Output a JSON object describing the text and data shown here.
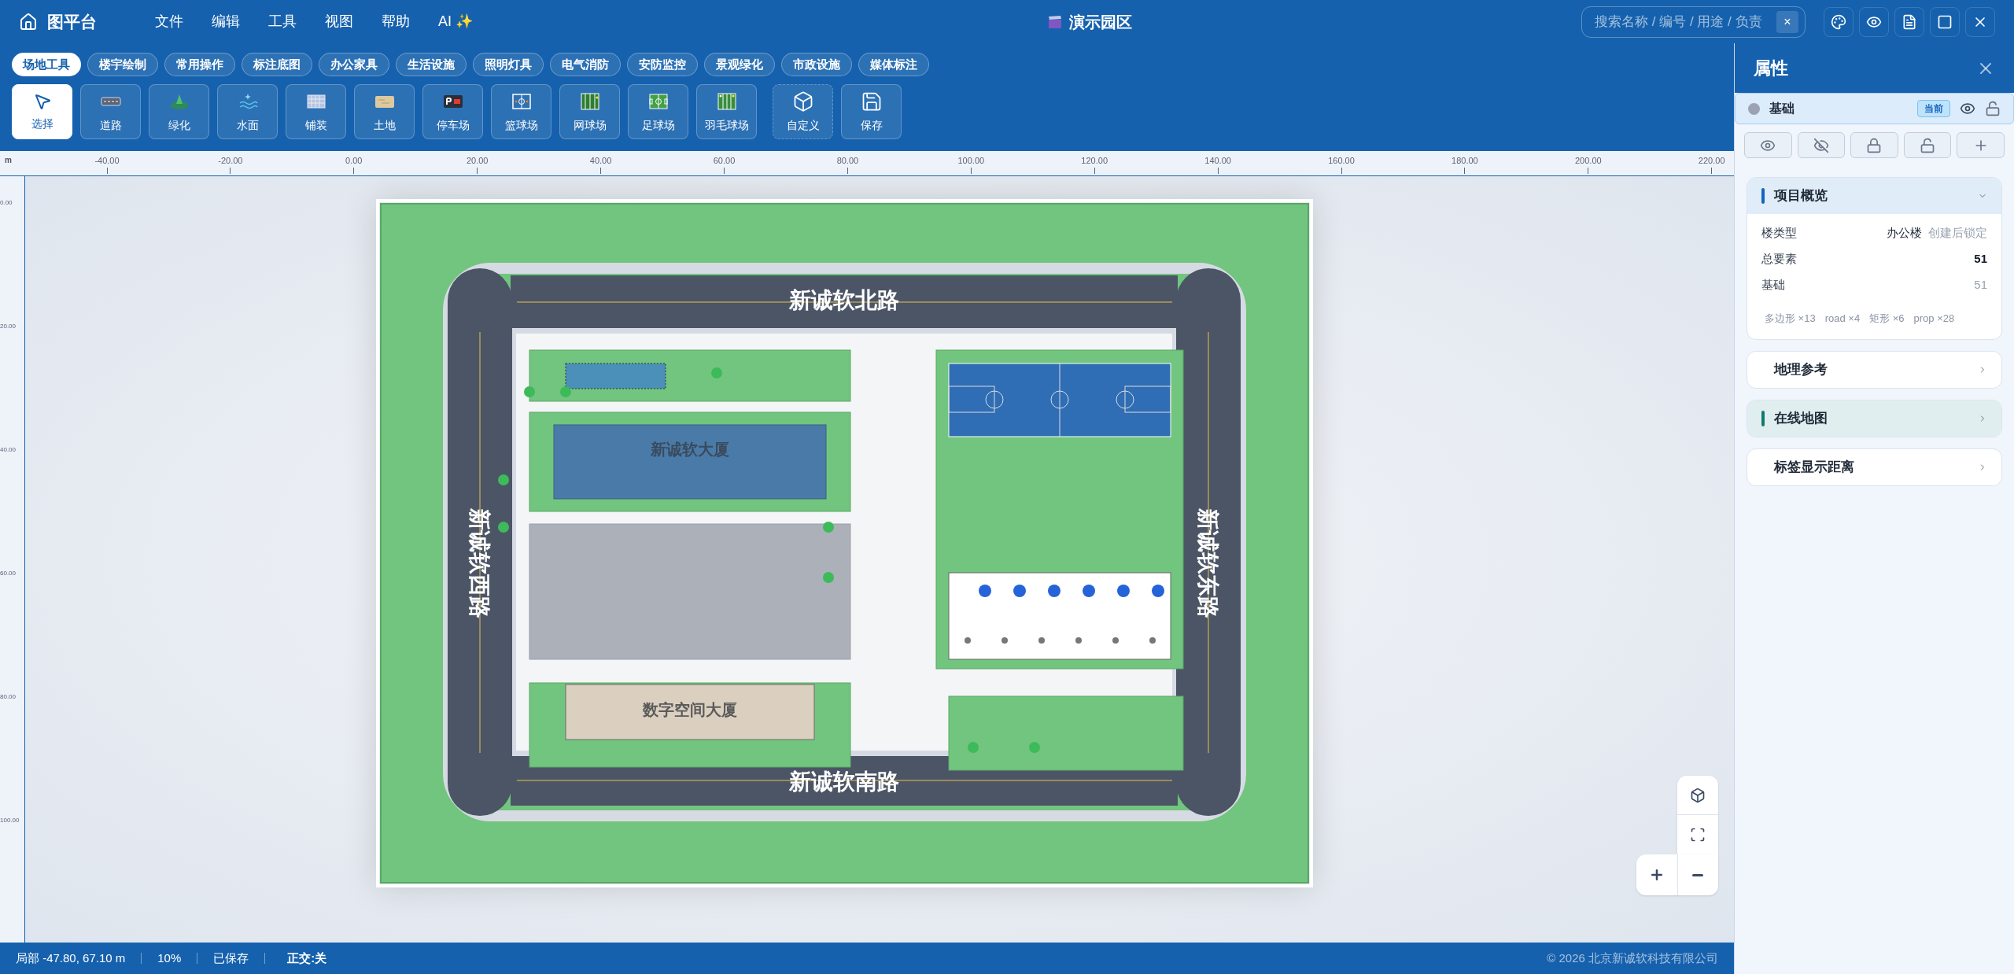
{
  "app": {
    "title": "图平台"
  },
  "menu": [
    {
      "label": "文件"
    },
    {
      "label": "编辑"
    },
    {
      "label": "工具"
    },
    {
      "label": "视图"
    },
    {
      "label": "帮助"
    },
    {
      "label": "AI ✨"
    }
  ],
  "project": {
    "title": "演示园区"
  },
  "search": {
    "placeholder": "搜索名称 / 编号 / 用途 / 负责",
    "clear": "×"
  },
  "tabs": [
    {
      "label": "场地工具",
      "selected": true
    },
    {
      "label": "楼宇绘制",
      "selected": false
    },
    {
      "label": "常用操作",
      "selected": false
    },
    {
      "label": "标注底图",
      "selected": false
    },
    {
      "label": "办公家具",
      "selected": false
    },
    {
      "label": "生活设施",
      "selected": false
    },
    {
      "label": "照明灯具",
      "selected": false
    },
    {
      "label": "电气消防",
      "selected": false
    },
    {
      "label": "安防监控",
      "selected": false
    },
    {
      "label": "景观绿化",
      "selected": false
    },
    {
      "label": "市政设施",
      "selected": false
    },
    {
      "label": "媒体标注",
      "selected": false
    }
  ],
  "tools": [
    {
      "label": "选择",
      "kind": "select",
      "selected": true
    },
    {
      "label": "道路",
      "kind": "road",
      "selected": false
    },
    {
      "label": "绿化",
      "kind": "green",
      "selected": false
    },
    {
      "label": "水面",
      "kind": "water",
      "selected": false
    },
    {
      "label": "铺装",
      "kind": "paving",
      "selected": false
    },
    {
      "label": "土地",
      "kind": "land",
      "selected": false
    },
    {
      "label": "停车场",
      "kind": "parking",
      "selected": false
    },
    {
      "label": "篮球场",
      "kind": "basketball",
      "selected": false
    },
    {
      "label": "网球场",
      "kind": "tennis",
      "selected": false
    },
    {
      "label": "足球场",
      "kind": "soccer",
      "selected": false
    },
    {
      "label": "羽毛球场",
      "kind": "badminton",
      "selected": false
    },
    {
      "label": "自定义",
      "kind": "custom",
      "selected": false
    },
    {
      "label": "保存",
      "kind": "save",
      "selected": false
    }
  ],
  "ruler": {
    "unit": "m",
    "x_ticks": [
      "-40.00",
      "-20.00",
      "0.00",
      "20.00",
      "40.00",
      "60.00",
      "80.00",
      "100.00",
      "120.00",
      "140.00",
      "160.00",
      "180.00",
      "200.00",
      "220.00"
    ],
    "y_ticks": [
      "0.00",
      "20.00",
      "40.00",
      "60.00",
      "80.00",
      "100.00"
    ]
  },
  "map": {
    "roads": [
      {
        "label": "新诚软北路",
        "kind": "north"
      },
      {
        "label": "新诚软南路",
        "kind": "south"
      },
      {
        "label": "新诚软西路",
        "kind": "west"
      },
      {
        "label": "新诚软东路",
        "kind": "east"
      }
    ],
    "buildings": [
      {
        "label": "新诚软大厦",
        "kind": "office"
      },
      {
        "label": "数字空间大厦",
        "kind": "tower"
      }
    ]
  },
  "panel": {
    "title": "属性",
    "layer": {
      "name": "基础",
      "badge": "当前",
      "color": "#9aa2b4"
    },
    "sections": [
      {
        "title": "项目概览",
        "expanded": true,
        "color": "#1565c0",
        "rows": [
          {
            "label": "楼类型",
            "value": "办公楼",
            "note": "创建后锁定",
            "kind": "plain"
          },
          {
            "label": "总要素",
            "value": "51",
            "kind": "strong"
          },
          {
            "label": "基础",
            "value": "51",
            "kind": "muted"
          }
        ],
        "tags": [
          "多边形 ×13",
          "road ×4",
          "矩形 ×6",
          "prop ×28"
        ]
      },
      {
        "title": "地理参考",
        "expanded": false
      },
      {
        "title": "在线地图",
        "expanded": false,
        "color": "#127a6e"
      },
      {
        "title": "标签显示距离",
        "expanded": false
      }
    ]
  },
  "status": {
    "coords": "局部 -47.80, 67.10 m",
    "zoom": "10%",
    "saved": "已保存",
    "ortho": "正交:关",
    "copyright": "© 2026 北京新诚软科技有限公司"
  }
}
